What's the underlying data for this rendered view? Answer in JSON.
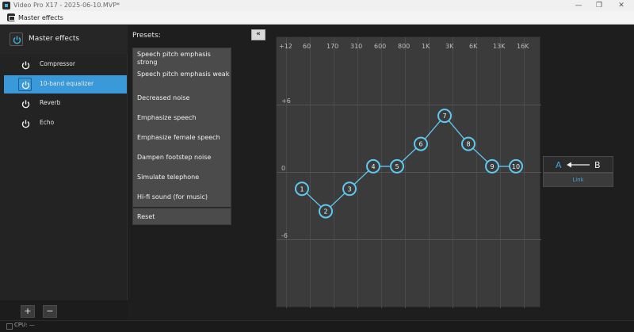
{
  "window": {
    "title": "Video Pro X17 - 2025-06-10.MVP*",
    "minimize": "—",
    "maximize": "❐",
    "close": "✕"
  },
  "dialog": {
    "title": "Master effects"
  },
  "sidebar": {
    "master_label": "Master effects",
    "items": [
      {
        "label": "Compressor"
      },
      {
        "label": "10-band equalizer"
      },
      {
        "label": "Reverb"
      },
      {
        "label": "Echo"
      }
    ],
    "selected_index": 1,
    "add_label": "+",
    "remove_label": "−"
  },
  "presets": {
    "title": "Presets:",
    "items": [
      {
        "label": "Speech pitch emphasis strong"
      },
      {
        "label": "Speech pitch emphasis weak"
      },
      {
        "label": "Decreased noise"
      },
      {
        "label": "Emphasize speech"
      },
      {
        "label": "Emphasize female speech"
      },
      {
        "label": "Dampen footstep noise"
      },
      {
        "label": "Simulate telephone"
      },
      {
        "label": "Hi-fi sound (for music)"
      }
    ],
    "reset_label": "Reset"
  },
  "collapse_label": "«",
  "equalizer": {
    "bands": [
      "+12",
      "60",
      "170",
      "310",
      "600",
      "800",
      "1K",
      "3K",
      "6K",
      "13K",
      "16K"
    ],
    "y_labels": [
      "+6",
      "0",
      "-6"
    ],
    "nodes": [
      {
        "label": "1",
        "gain": -1.5
      },
      {
        "label": "2",
        "gain": -3.5
      },
      {
        "label": "3",
        "gain": -1.5
      },
      {
        "label": "4",
        "gain": 0.5
      },
      {
        "label": "5",
        "gain": 0.5
      },
      {
        "label": "6",
        "gain": 2.5
      },
      {
        "label": "7",
        "gain": 5.0
      },
      {
        "label": "8",
        "gain": 2.5
      },
      {
        "label": "9",
        "gain": 0.5
      },
      {
        "label": "10",
        "gain": 0.5
      }
    ],
    "accent": "#5ec8ee"
  },
  "ab": {
    "a_label": "A",
    "b_label": "B",
    "link_label": "Link"
  },
  "status": {
    "cpu_label": "CPU: —"
  }
}
